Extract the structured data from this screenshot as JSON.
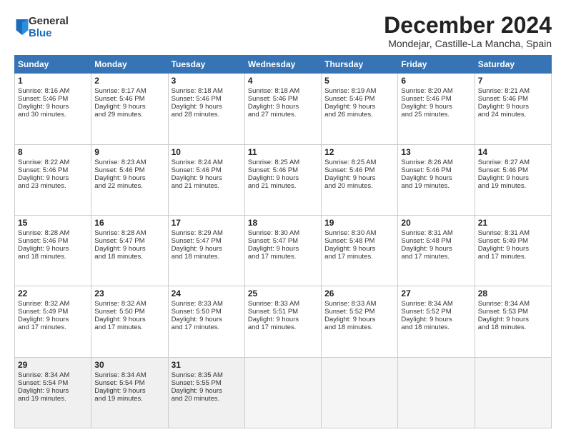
{
  "logo": {
    "general": "General",
    "blue": "Blue"
  },
  "title": "December 2024",
  "location": "Mondejar, Castille-La Mancha, Spain",
  "days_of_week": [
    "Sunday",
    "Monday",
    "Tuesday",
    "Wednesday",
    "Thursday",
    "Friday",
    "Saturday"
  ],
  "weeks": [
    [
      {
        "day": 1,
        "info": "Sunrise: 8:16 AM\nSunset: 5:46 PM\nDaylight: 9 hours\nand 30 minutes."
      },
      {
        "day": 2,
        "info": "Sunrise: 8:17 AM\nSunset: 5:46 PM\nDaylight: 9 hours\nand 29 minutes."
      },
      {
        "day": 3,
        "info": "Sunrise: 8:18 AM\nSunset: 5:46 PM\nDaylight: 9 hours\nand 28 minutes."
      },
      {
        "day": 4,
        "info": "Sunrise: 8:18 AM\nSunset: 5:46 PM\nDaylight: 9 hours\nand 27 minutes."
      },
      {
        "day": 5,
        "info": "Sunrise: 8:19 AM\nSunset: 5:46 PM\nDaylight: 9 hours\nand 26 minutes."
      },
      {
        "day": 6,
        "info": "Sunrise: 8:20 AM\nSunset: 5:46 PM\nDaylight: 9 hours\nand 25 minutes."
      },
      {
        "day": 7,
        "info": "Sunrise: 8:21 AM\nSunset: 5:46 PM\nDaylight: 9 hours\nand 24 minutes."
      }
    ],
    [
      {
        "day": 8,
        "info": "Sunrise: 8:22 AM\nSunset: 5:46 PM\nDaylight: 9 hours\nand 23 minutes."
      },
      {
        "day": 9,
        "info": "Sunrise: 8:23 AM\nSunset: 5:46 PM\nDaylight: 9 hours\nand 22 minutes."
      },
      {
        "day": 10,
        "info": "Sunrise: 8:24 AM\nSunset: 5:46 PM\nDaylight: 9 hours\nand 21 minutes."
      },
      {
        "day": 11,
        "info": "Sunrise: 8:25 AM\nSunset: 5:46 PM\nDaylight: 9 hours\nand 21 minutes."
      },
      {
        "day": 12,
        "info": "Sunrise: 8:25 AM\nSunset: 5:46 PM\nDaylight: 9 hours\nand 20 minutes."
      },
      {
        "day": 13,
        "info": "Sunrise: 8:26 AM\nSunset: 5:46 PM\nDaylight: 9 hours\nand 19 minutes."
      },
      {
        "day": 14,
        "info": "Sunrise: 8:27 AM\nSunset: 5:46 PM\nDaylight: 9 hours\nand 19 minutes."
      }
    ],
    [
      {
        "day": 15,
        "info": "Sunrise: 8:28 AM\nSunset: 5:46 PM\nDaylight: 9 hours\nand 18 minutes."
      },
      {
        "day": 16,
        "info": "Sunrise: 8:28 AM\nSunset: 5:47 PM\nDaylight: 9 hours\nand 18 minutes."
      },
      {
        "day": 17,
        "info": "Sunrise: 8:29 AM\nSunset: 5:47 PM\nDaylight: 9 hours\nand 18 minutes."
      },
      {
        "day": 18,
        "info": "Sunrise: 8:30 AM\nSunset: 5:47 PM\nDaylight: 9 hours\nand 17 minutes."
      },
      {
        "day": 19,
        "info": "Sunrise: 8:30 AM\nSunset: 5:48 PM\nDaylight: 9 hours\nand 17 minutes."
      },
      {
        "day": 20,
        "info": "Sunrise: 8:31 AM\nSunset: 5:48 PM\nDaylight: 9 hours\nand 17 minutes."
      },
      {
        "day": 21,
        "info": "Sunrise: 8:31 AM\nSunset: 5:49 PM\nDaylight: 9 hours\nand 17 minutes."
      }
    ],
    [
      {
        "day": 22,
        "info": "Sunrise: 8:32 AM\nSunset: 5:49 PM\nDaylight: 9 hours\nand 17 minutes."
      },
      {
        "day": 23,
        "info": "Sunrise: 8:32 AM\nSunset: 5:50 PM\nDaylight: 9 hours\nand 17 minutes."
      },
      {
        "day": 24,
        "info": "Sunrise: 8:33 AM\nSunset: 5:50 PM\nDaylight: 9 hours\nand 17 minutes."
      },
      {
        "day": 25,
        "info": "Sunrise: 8:33 AM\nSunset: 5:51 PM\nDaylight: 9 hours\nand 17 minutes."
      },
      {
        "day": 26,
        "info": "Sunrise: 8:33 AM\nSunset: 5:52 PM\nDaylight: 9 hours\nand 18 minutes."
      },
      {
        "day": 27,
        "info": "Sunrise: 8:34 AM\nSunset: 5:52 PM\nDaylight: 9 hours\nand 18 minutes."
      },
      {
        "day": 28,
        "info": "Sunrise: 8:34 AM\nSunset: 5:53 PM\nDaylight: 9 hours\nand 18 minutes."
      }
    ],
    [
      {
        "day": 29,
        "info": "Sunrise: 8:34 AM\nSunset: 5:54 PM\nDaylight: 9 hours\nand 19 minutes."
      },
      {
        "day": 30,
        "info": "Sunrise: 8:34 AM\nSunset: 5:54 PM\nDaylight: 9 hours\nand 19 minutes."
      },
      {
        "day": 31,
        "info": "Sunrise: 8:35 AM\nSunset: 5:55 PM\nDaylight: 9 hours\nand 20 minutes."
      },
      null,
      null,
      null,
      null
    ]
  ]
}
